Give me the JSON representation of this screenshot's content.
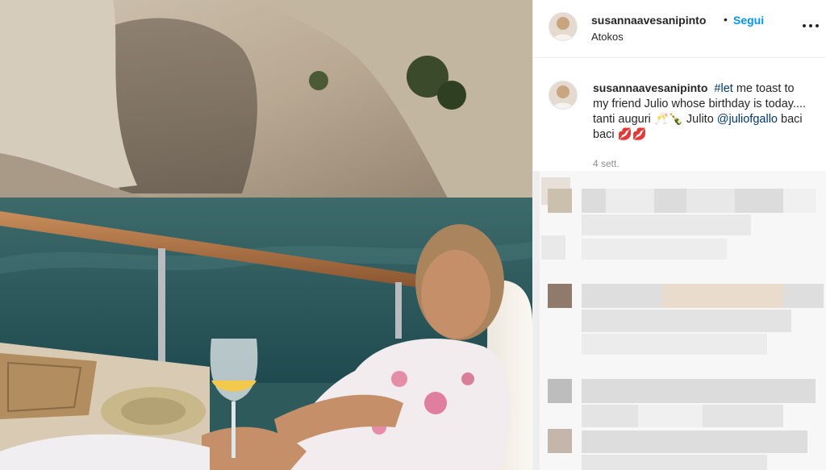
{
  "post": {
    "username": "susannaavesanipinto",
    "dot": "•",
    "follow_label": "Segui",
    "location": "Atokos",
    "more_icon": "more-options-icon"
  },
  "caption": {
    "username": "susannaavesanipinto",
    "hashtag": "#let",
    "text_1": "me toast to my friend Julio whose birthday is today.... tanti auguri 🥂🍾 Julito",
    "mention": "@juliofgallo",
    "text_2": "baci baci 💋💋"
  },
  "timestamp": "4 sett.",
  "colors": {
    "follow": "#0095f6",
    "link": "#00376b",
    "muted": "#8e8e8e"
  }
}
